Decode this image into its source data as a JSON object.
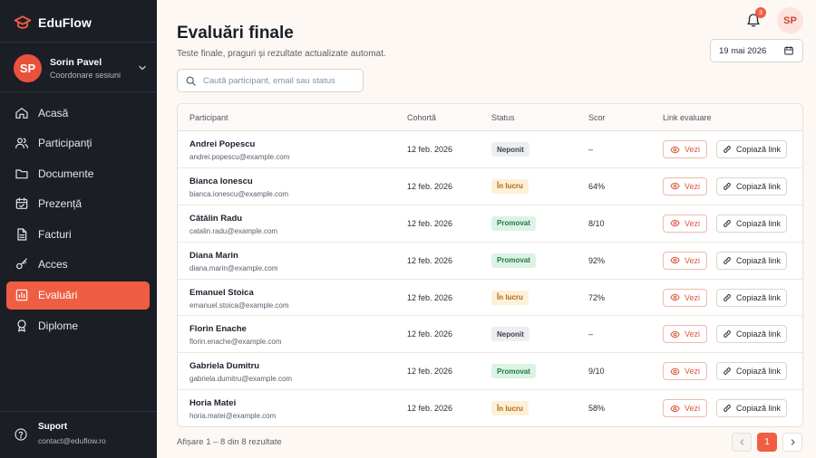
{
  "brand": {
    "name": "EduFlow",
    "icon": "graduation-cap-icon"
  },
  "user": {
    "initials": "SP",
    "name": "Sorin Pavel",
    "role": "Coordonare sesiuni"
  },
  "nav": [
    {
      "label": "Acasă",
      "icon": "home-icon",
      "active": false
    },
    {
      "label": "Participanți",
      "icon": "users-icon",
      "active": false
    },
    {
      "label": "Documente",
      "icon": "folder-icon",
      "active": false
    },
    {
      "label": "Prezență",
      "icon": "calendar-check-icon",
      "active": false
    },
    {
      "label": "Facturi",
      "icon": "invoice-icon",
      "active": false
    },
    {
      "label": "Acces",
      "icon": "key-icon",
      "active": false
    },
    {
      "label": "Evaluări",
      "icon": "chart-icon",
      "active": true
    },
    {
      "label": "Diplome",
      "icon": "award-icon",
      "active": false
    }
  ],
  "support": {
    "title": "Suport",
    "email": "contact@eduflow.ro"
  },
  "header": {
    "title": "Evaluări finale",
    "subtitle": "Teste finale, praguri și rezultate actualizate automat.",
    "notifications": "3",
    "avatar_initials": "SP",
    "date": "19 mai 2026"
  },
  "search": {
    "placeholder": "Caută participant, email sau status",
    "value": ""
  },
  "table": {
    "columns": [
      "Participant",
      "Cohortă",
      "Status",
      "Scor",
      "Link evaluare"
    ],
    "view_label": "Vezi",
    "copy_label": "Copiază link",
    "rows": [
      {
        "name": "Andrei Popescu",
        "email": "andrei.popescu@example.com",
        "cohort": "12 feb. 2026",
        "status": "Neponit",
        "status_kind": "neutral",
        "score": "–"
      },
      {
        "name": "Bianca Ionescu",
        "email": "bianca.ionescu@example.com",
        "cohort": "12 feb. 2026",
        "status": "În lucru",
        "status_kind": "warn",
        "score": "64%"
      },
      {
        "name": "Cătălin Radu",
        "email": "catalin.radu@example.com",
        "cohort": "12 feb. 2026",
        "status": "Promovat",
        "status_kind": "ok",
        "score": "8/10"
      },
      {
        "name": "Diana Marin",
        "email": "diana.marin@example.com",
        "cohort": "12 feb. 2026",
        "status": "Promovat",
        "status_kind": "ok",
        "score": "92%"
      },
      {
        "name": "Emanuel Stoica",
        "email": "emanuel.stoica@example.com",
        "cohort": "12 feb. 2026",
        "status": "În lucru",
        "status_kind": "warn",
        "score": "72%"
      },
      {
        "name": "Florin Enache",
        "email": "florin.enache@example.com",
        "cohort": "12 feb. 2026",
        "status": "Neponit",
        "status_kind": "neutral",
        "score": "–"
      },
      {
        "name": "Gabriela Dumitru",
        "email": "gabriela.dumitru@example.com",
        "cohort": "12 feb. 2026",
        "status": "Promovat",
        "status_kind": "ok",
        "score": "9/10"
      },
      {
        "name": "Horia Matei",
        "email": "horia.matei@example.com",
        "cohort": "12 feb. 2026",
        "status": "În lucru",
        "status_kind": "warn",
        "score": "58%"
      }
    ]
  },
  "footer": {
    "summary": "Afișare 1 – 8 din 8 rezultate",
    "current_page": "1"
  },
  "colors": {
    "accent": "#ef5e42",
    "sidebar": "#1c1e26",
    "background": "#fdf8f4"
  }
}
